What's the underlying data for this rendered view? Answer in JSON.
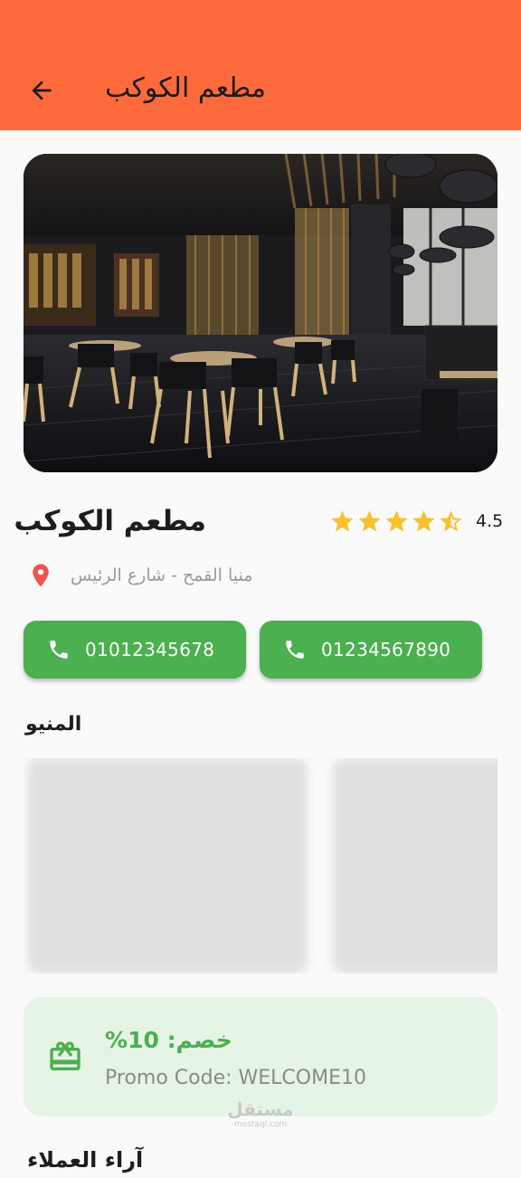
{
  "appbar": {
    "title": "مطعم الكوكب",
    "back_icon": "arrow-back-icon",
    "color": "#ff6a3d"
  },
  "restaurant": {
    "name": "مطعم الكوكب",
    "rating": "4.5",
    "stars_filled": 4,
    "stars_half": 1,
    "star_color": "#fbc02d",
    "address": "منيا القمح - شارع الرئيس",
    "pin_color": "#ef5350"
  },
  "phones": [
    {
      "number": "01012345678",
      "icon": "phone-icon"
    },
    {
      "number": "01234567890",
      "icon": "phone-icon"
    }
  ],
  "menu": {
    "title": "المنيو"
  },
  "promo": {
    "discount": "%خصم: 10",
    "code": "Promo Code: WELCOME10",
    "icon": "gift-card-icon",
    "accent": "#4caf50"
  },
  "watermark": {
    "main": "مستقل",
    "sub": "mostaql.com"
  },
  "next_section": {
    "title": "آراء العملاء"
  }
}
